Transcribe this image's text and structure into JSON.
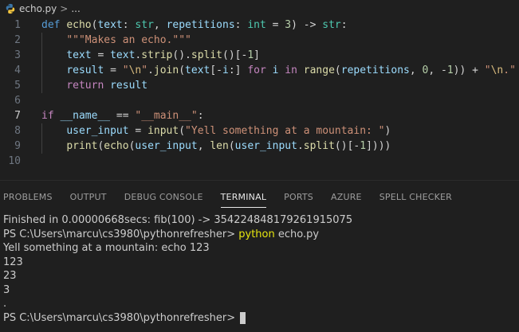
{
  "breadcrumb": {
    "file": "echo.py",
    "sep": ">",
    "more": "..."
  },
  "editor": {
    "line_numbers": [
      "1",
      "2",
      "3",
      "4",
      "5",
      "6",
      "7",
      "8",
      "9",
      "10"
    ],
    "active_line": 7
  },
  "panel": {
    "tabs": [
      "PROBLEMS",
      "OUTPUT",
      "DEBUG CONSOLE",
      "TERMINAL",
      "PORTS",
      "AZURE",
      "SPELL CHECKER"
    ],
    "active_tab": "TERMINAL"
  },
  "terminal": {
    "lines": [
      "Finished in 0.00000668secs: fib(100) -> 354224848179261915075"
    ],
    "prompt1": "PS C:\\Users\\marcu\\cs3980\\pythonrefresher>",
    "command": "python",
    "command_arg": "echo.py",
    "output": [
      "Yell something at a mountain: echo 123",
      "123",
      "23",
      "3",
      "."
    ],
    "prompt2": "PS C:\\Users\\marcu\\cs3980\\pythonrefresher>"
  },
  "colors": {
    "keyword": "#569cd6",
    "function": "#dcdcaa",
    "string": "#ce9178",
    "variable": "#9cdcfe",
    "type": "#4ec9b0",
    "number": "#b5cea8",
    "control": "#c586c0"
  }
}
